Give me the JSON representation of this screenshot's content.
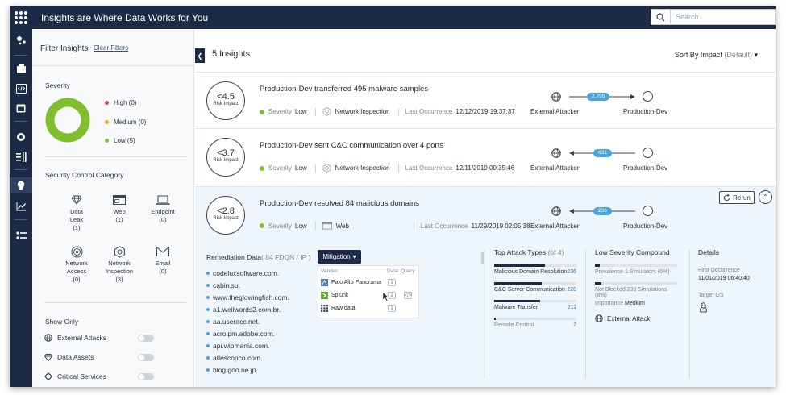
{
  "app": {
    "title": "Insights are Where Data Works for You"
  },
  "search": {
    "placeholder": "Search"
  },
  "filters": {
    "heading": "Filter Insights",
    "clear_label": "Clear Filters",
    "severity": {
      "title": "Severity",
      "items": [
        {
          "label": "High (0)",
          "color": "#e0434f"
        },
        {
          "label": "Medium (0)",
          "color": "#f0a830"
        },
        {
          "label": "Low (5)",
          "color": "#7fbf2e"
        }
      ],
      "donut_color": "#7fbf2e"
    },
    "category": {
      "title": "Security Control Category",
      "items": [
        {
          "name": "Data",
          "name2": "Leak",
          "count": "(1)",
          "icon": "diamond-icon"
        },
        {
          "name": "Web",
          "count": "(1)",
          "icon": "browser-icon"
        },
        {
          "name": "Endpoint",
          "count": "(0)",
          "icon": "laptop-icon"
        },
        {
          "name": "Network",
          "name2": "Access",
          "count": "(0)",
          "icon": "target-icon"
        },
        {
          "name": "Network",
          "name2": "Inspection",
          "count": "(3)",
          "icon": "network-inspection-icon"
        },
        {
          "name": "Email",
          "count": "(0)",
          "icon": "envelope-icon"
        }
      ]
    },
    "show_only": {
      "title": "Show Only",
      "items": [
        {
          "label": "External Attacks",
          "icon": "globe-icon"
        },
        {
          "label": "Data Assets",
          "icon": "diamond-icon"
        },
        {
          "label": "Critical Services",
          "icon": "crosshair-icon"
        }
      ]
    }
  },
  "main": {
    "count_label": "5 Insights",
    "sort_label": "Sort By Impact",
    "sort_default": "(Default)",
    "insights": [
      {
        "risk_value": "<4.5",
        "risk_label": "Risk Impact",
        "title": "Production-Dev transferred 495 malware samples",
        "severity_label": "Severity",
        "severity_value": "Low",
        "category": "Network Inspection",
        "occurrence_label": "Last Occurrence",
        "occurrence": "12/12/2019 19:37:37",
        "from": "External Attacker",
        "to": "Production-Dev",
        "flow_count": "2,795",
        "direction": "right"
      },
      {
        "risk_value": "<3.7",
        "risk_label": "Risk Impact",
        "title": "Production-Dev sent C&C communication over 4 ports",
        "severity_label": "Severity",
        "severity_value": "Low",
        "category": "Network Inspection",
        "occurrence_label": "Last Occurrence",
        "occurrence": "12/11/2019 00:35:46",
        "from": "External Attacker",
        "to": "Production-Dev",
        "flow_count": "631",
        "direction": "left"
      },
      {
        "risk_value": "<2.8",
        "risk_label": "Risk Impact",
        "title": "Production-Dev resolved 84 malicious domains",
        "severity_label": "Severity",
        "severity_value": "Low",
        "category": "Web",
        "occurrence_label": "Last Occurrence",
        "occurrence": "11/29/2019 02:05:38",
        "from": "External Attacker",
        "to": "Production-Dev",
        "flow_count": "236",
        "direction": "left"
      }
    ],
    "rerun_label": "Rerun",
    "remediation": {
      "title": "Remediation Data",
      "count": "( 84 FDQN / IP )",
      "mitigation_label": "Mitigation",
      "domains": [
        "codeluxsoftware.com.",
        "cabin.su.",
        "www.theglowingfish.com.",
        "a1.weilwords2.com.br.",
        "aa.useracc.net.",
        "acroipm.adobe.com.",
        "api.wipmania.com.",
        "atlescopco.com.",
        "blog.goo.ne.jp."
      ],
      "vendor_header": "Vendor",
      "data_header": "Data",
      "query_header": "Query",
      "vendors": [
        {
          "name": "Palo Alto Panorama",
          "icon": "palo-alto-icon"
        },
        {
          "name": "Splunk",
          "icon": "splunk-icon"
        },
        {
          "name": "Raw data",
          "icon": "grid-icon"
        }
      ]
    },
    "top_attack_types": {
      "title": "Top Attack Types",
      "count": "(of 4)",
      "items": [
        {
          "label": "Malicious Domain Resolution",
          "value": "236",
          "fill": 0.62
        },
        {
          "label": "C&C Server Communication",
          "value": "220",
          "fill": 0.58
        },
        {
          "label": "Malware Transfer",
          "value": "211",
          "fill": 0.56
        },
        {
          "label": "Remote Control",
          "value": "7",
          "fill": 0.02
        }
      ]
    },
    "low_severity": {
      "title": "Low Severity Compound",
      "items": [
        {
          "label": "Prevalence 1 Simulators (6%)",
          "fill": 0.06
        },
        {
          "label": "Not Blocked 236 Simulations (8%)",
          "fill": 0.08
        }
      ],
      "importance_label": "Importance",
      "importance_value": "Medium",
      "attack_label": "External Attack"
    },
    "details": {
      "title": "Details",
      "first_label": "First Occurrence",
      "first_value": "11/01/2019 06:40:40",
      "os_label": "Target OS"
    }
  }
}
